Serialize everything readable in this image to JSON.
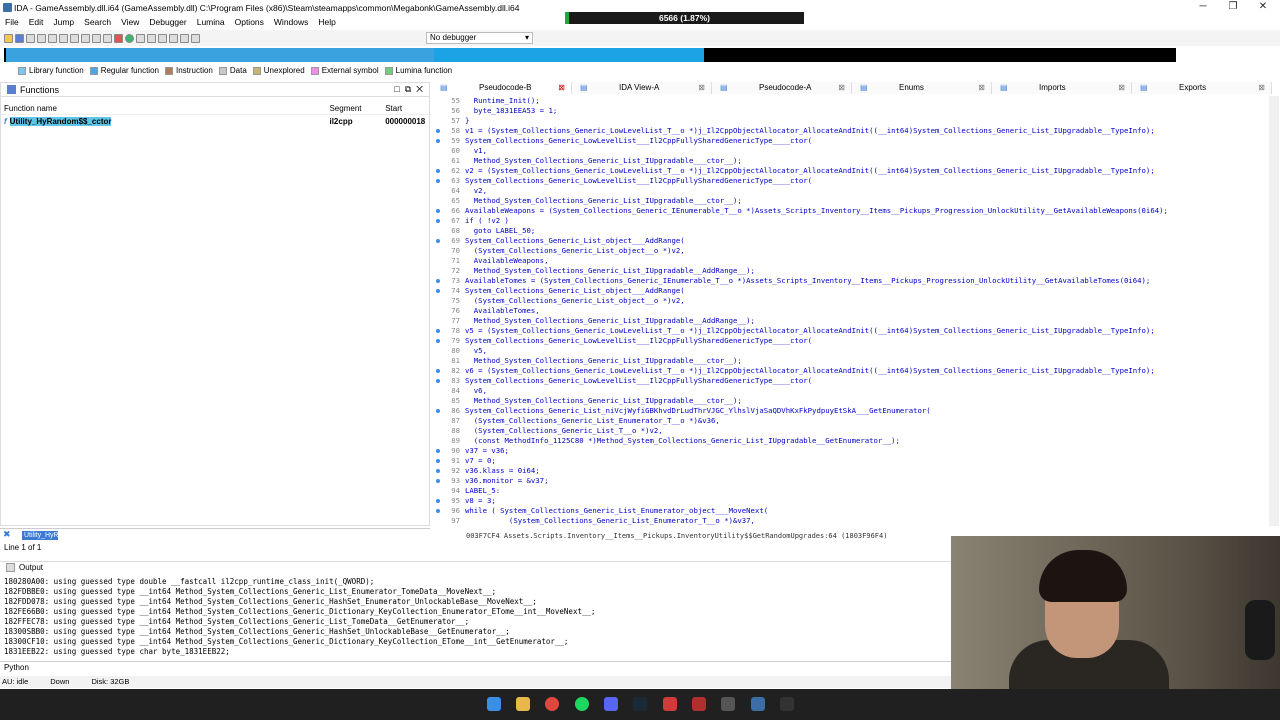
{
  "window": {
    "title": "IDA - GameAssembly.dll.i64 (GameAssembly.dll) C:\\Program Files (x86)\\Steam\\steamapps\\common\\Megabonk\\GameAssembly.dll.i64",
    "memory_label": "6566 (1.87%)",
    "memory_fraction": 0.0187
  },
  "menu": [
    "File",
    "Edit",
    "Jump",
    "Search",
    "View",
    "Debugger",
    "Lumina",
    "Options",
    "Windows",
    "Help"
  ],
  "toolbar": {
    "debugger_select": "No debugger"
  },
  "legend": [
    {
      "label": "Library function",
      "color": "#7ec6f0"
    },
    {
      "label": "Regular function",
      "color": "#4aa6e8"
    },
    {
      "label": "Instruction",
      "color": "#b07d5a"
    },
    {
      "label": "Data",
      "color": "#c8c8c8"
    },
    {
      "label": "Unexplored",
      "color": "#c8b46a"
    },
    {
      "label": "External symbol",
      "color": "#ee8fe6"
    },
    {
      "label": "Lumina function",
      "color": "#6ad07a"
    }
  ],
  "functions": {
    "title": "Functions",
    "columns": [
      "Function name",
      "Segment",
      "Start"
    ],
    "rows": [
      {
        "name": "Utility_HyRandom$$_cctor",
        "segment": "il2cpp",
        "start": "000000018"
      }
    ],
    "search_value": "Utility_HyR",
    "line_of": "Line 1 of 1"
  },
  "tabs": [
    {
      "label": "Pseudocode-B",
      "active": true
    },
    {
      "label": "IDA View-A",
      "active": false
    },
    {
      "label": "Pseudocode-A",
      "active": false
    },
    {
      "label": "Enums",
      "active": false
    },
    {
      "label": "Imports",
      "active": false
    },
    {
      "label": "Exports",
      "active": false
    }
  ],
  "code": [
    {
      "n": "55",
      "dot": false,
      "t": "  Runtime_Init();"
    },
    {
      "n": "56",
      "dot": false,
      "t": "  byte_1831EEA53 = 1;"
    },
    {
      "n": "57",
      "dot": false,
      "t": "}"
    },
    {
      "n": "58",
      "dot": true,
      "t": "v1 = (System_Collections_Generic_LowLevelList_T__o *)j_Il2CppObjectAllocator_AllocateAndInit((__int64)System_Collections_Generic_List_IUpgradable__TypeInfo);"
    },
    {
      "n": "59",
      "dot": true,
      "t": "System_Collections_Generic_LowLevelList___Il2CppFullySharedGenericType____ctor("
    },
    {
      "n": "60",
      "dot": false,
      "t": "  v1,"
    },
    {
      "n": "61",
      "dot": false,
      "t": "  Method_System_Collections_Generic_List_IUpgradable___ctor__);"
    },
    {
      "n": "62",
      "dot": true,
      "t": "v2 = (System_Collections_Generic_LowLevelList_T__o *)j_Il2CppObjectAllocator_AllocateAndInit((__int64)System_Collections_Generic_List_IUpgradable__TypeInfo);"
    },
    {
      "n": "63",
      "dot": true,
      "t": "System_Collections_Generic_LowLevelList___Il2CppFullySharedGenericType____ctor("
    },
    {
      "n": "64",
      "dot": false,
      "t": "  v2,"
    },
    {
      "n": "65",
      "dot": false,
      "t": "  Method_System_Collections_Generic_List_IUpgradable___ctor__);"
    },
    {
      "n": "66",
      "dot": true,
      "t": "AvailableWeapons = (System_Collections_Generic_IEnumerable_T__o *)Assets_Scripts_Inventory__Items__Pickups_Progression_UnlockUtility__GetAvailableWeapons(0i64);"
    },
    {
      "n": "67",
      "dot": true,
      "t": "if ( !v2 )"
    },
    {
      "n": "68",
      "dot": false,
      "t": "  goto LABEL_50;"
    },
    {
      "n": "69",
      "dot": true,
      "t": "System_Collections_Generic_List_object___AddRange("
    },
    {
      "n": "70",
      "dot": false,
      "t": "  (System_Collections_Generic_List_object__o *)v2,"
    },
    {
      "n": "71",
      "dot": false,
      "t": "  AvailableWeapons,"
    },
    {
      "n": "72",
      "dot": false,
      "t": "  Method_System_Collections_Generic_List_IUpgradable__AddRange__);"
    },
    {
      "n": "73",
      "dot": true,
      "t": "AvailableTomes = (System_Collections_Generic_IEnumerable_T__o *)Assets_Scripts_Inventory__Items__Pickups_Progression_UnlockUtility__GetAvailableTomes(0i64);"
    },
    {
      "n": "74",
      "dot": true,
      "t": "System_Collections_Generic_List_object___AddRange("
    },
    {
      "n": "75",
      "dot": false,
      "t": "  (System_Collections_Generic_List_object__o *)v2,"
    },
    {
      "n": "76",
      "dot": false,
      "t": "  AvailableTomes,"
    },
    {
      "n": "77",
      "dot": false,
      "t": "  Method_System_Collections_Generic_List_IUpgradable__AddRange__);"
    },
    {
      "n": "78",
      "dot": true,
      "t": "v5 = (System_Collections_Generic_LowLevelList_T__o *)j_Il2CppObjectAllocator_AllocateAndInit((__int64)System_Collections_Generic_List_IUpgradable__TypeInfo);"
    },
    {
      "n": "79",
      "dot": true,
      "t": "System_Collections_Generic_LowLevelList___Il2CppFullySharedGenericType____ctor("
    },
    {
      "n": "80",
      "dot": false,
      "t": "  v5,"
    },
    {
      "n": "81",
      "dot": false,
      "t": "  Method_System_Collections_Generic_List_IUpgradable___ctor__);"
    },
    {
      "n": "82",
      "dot": true,
      "t": "v6 = (System_Collections_Generic_LowLevelList_T__o *)j_Il2CppObjectAllocator_AllocateAndInit((__int64)System_Collections_Generic_List_IUpgradable__TypeInfo);"
    },
    {
      "n": "83",
      "dot": true,
      "t": "System_Collections_Generic_LowLevelList___Il2CppFullySharedGenericType____ctor("
    },
    {
      "n": "84",
      "dot": false,
      "t": "  v6,"
    },
    {
      "n": "85",
      "dot": false,
      "t": "  Method_System_Collections_Generic_List_IUpgradable___ctor__);"
    },
    {
      "n": "86",
      "dot": true,
      "t": "System_Collections_Generic_List_niVcjWyfiGBKhvdDrLudThrVJGC_YlhslVjaSaQDVhKxFkPydpuyEtSkA___GetEnumerator("
    },
    {
      "n": "87",
      "dot": false,
      "t": "  (System_Collections_Generic_List_Enumerator_T__o *)&v36,"
    },
    {
      "n": "88",
      "dot": false,
      "t": "  (System_Collections_Generic_List_T__o *)v2,"
    },
    {
      "n": "89",
      "dot": false,
      "t": "  (const MethodInfo_1125C80 *)Method_System_Collections_Generic_List_IUpgradable__GetEnumerator__);"
    },
    {
      "n": "90",
      "dot": true,
      "t": "v37 = v36;"
    },
    {
      "n": "91",
      "dot": true,
      "t": "v7 = 0;"
    },
    {
      "n": "92",
      "dot": true,
      "t": "v36.klass = 0i64;"
    },
    {
      "n": "93",
      "dot": true,
      "t": "v36.monitor = &v37;"
    },
    {
      "n": "94",
      "dot": false,
      "t": "LABEL_5:"
    },
    {
      "n": "95",
      "dot": true,
      "t": "v8 = 3;"
    },
    {
      "n": "96",
      "dot": true,
      "t": "while ( System_Collections_Generic_List_Enumerator_object___MoveNext("
    },
    {
      "n": "97",
      "dot": false,
      "t": "          (System_Collections_Generic_List_Enumerator_T__o *)&v37,"
    }
  ],
  "code_status": "003F7CF4 Assets.Scripts.Inventory__Items__Pickups.InventoryUtility$$GetRandomUpgrades:64 (1803F96F4)",
  "output": {
    "title": "Output",
    "lines": [
      "180280A00: using guessed type double __fastcall il2cpp_runtime_class_init(_QWORD);",
      "182FDBBE0: using guessed type __int64 Method_System_Collections_Generic_List_Enumerator_TomeData__MoveNext__;",
      "182FDD078: using guessed type __int64 Method_System_Collections_Generic_HashSet_Enumerator_UnlockableBase__MoveNext__;",
      "182FE66B0: using guessed type __int64 Method_System_Collections_Generic_Dictionary_KeyCollection_Enumerator_ETome__int__MoveNext__;",
      "182FFEC78: using guessed type __int64 Method_System_Collections_Generic_List_TomeData__GetEnumerator__;",
      "18300SBB0: using guessed type __int64 Method_System_Collections_Generic_HashSet_UnlockableBase__GetEnumerator__;",
      "18300CF10: using guessed type __int64 Method_System_Collections_Generic_Dictionary_KeyCollection_ETome__int__GetEnumerator__;",
      "1831EEB22: using guessed type char byte_1831EEB22;"
    ]
  },
  "python_label": "Python",
  "status": {
    "au": "AU:  idle",
    "dir": "Down",
    "disk": "Disk: 32GB"
  }
}
